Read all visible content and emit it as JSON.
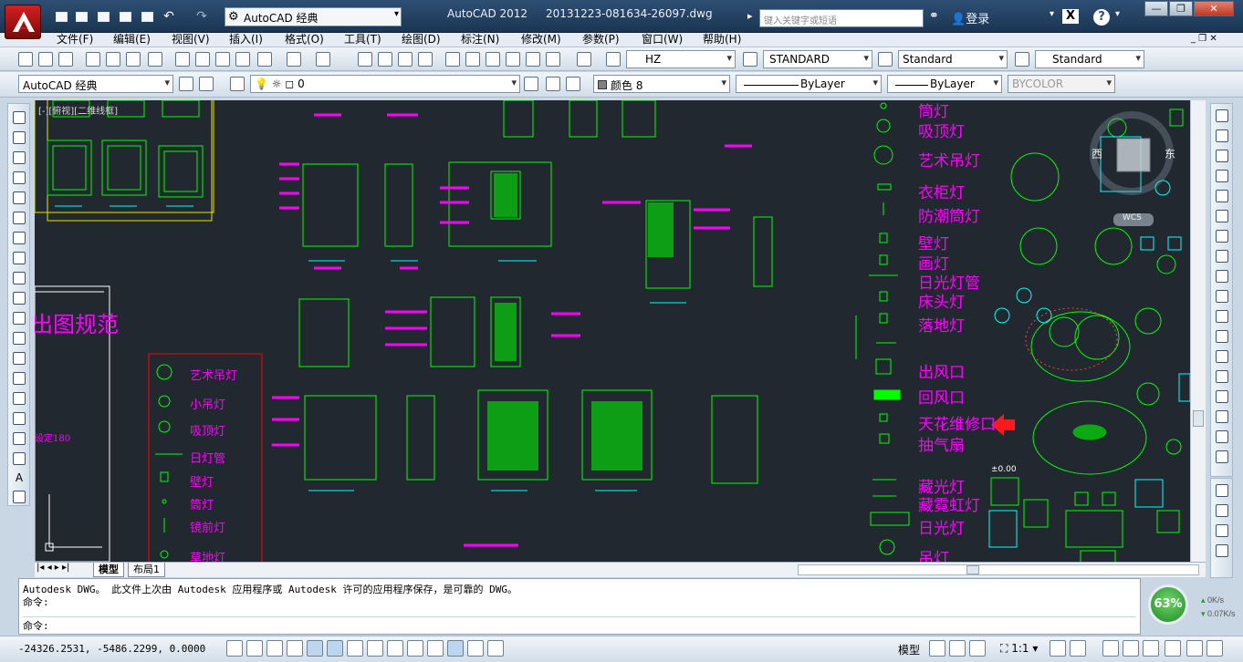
{
  "titlebar": {
    "workspace": "AutoCAD 经典",
    "app_title": "AutoCAD 2012",
    "file_title": "20131223-081634-26097.dwg",
    "search_placeholder": "键入关键字或短语",
    "login": "登录"
  },
  "menu": [
    "文件(F)",
    "编辑(E)",
    "视图(V)",
    "插入(I)",
    "格式(O)",
    "工具(T)",
    "绘图(D)",
    "标注(N)",
    "修改(M)",
    "参数(P)",
    "窗口(W)",
    "帮助(H)"
  ],
  "toolbar": {
    "text_style": "HZ",
    "dim_style": "STANDARD",
    "table_style": "Standard",
    "mleader_style": "Standard",
    "workspace2": "AutoCAD 经典",
    "layer": "0",
    "color": "颜色 8",
    "linetype": "ByLayer",
    "lineweight": "ByLayer",
    "plotstyle": "BYCOLOR"
  },
  "viewcube": {
    "west": "西",
    "east": "东",
    "wcs": "WCS"
  },
  "drawing": {
    "viewport_label": "[-][俯视][二维线框]",
    "big_title": "出图规范",
    "left_legend": [
      "艺术吊灯",
      "小吊灯",
      "吸顶灯",
      "日灯管",
      "壁灯",
      "筒灯",
      "镜前灯",
      "草地灯"
    ],
    "left_small": "设定180",
    "right_legend": [
      "筒灯",
      "吸顶灯",
      "艺术吊灯",
      "衣柜灯",
      "防潮筒灯",
      "壁灯",
      "画灯",
      "日光灯管",
      "床头灯",
      "落地灯",
      "出风口",
      "回风口",
      "天花维修口",
      "抽气扇",
      "藏光灯",
      "藏霓虹灯",
      "日光灯",
      "吊灯"
    ],
    "elev_label": "±0.00"
  },
  "tabs": {
    "model": "模型",
    "layout1": "布局1"
  },
  "command": {
    "line1": "Autodesk DWG。  此文件上次由 Autodesk 应用程序或 Autodesk 许可的应用程序保存，是可靠的 DWG。",
    "line2": "命令:",
    "prompt": "命令:"
  },
  "status": {
    "coords": "-24326.2531, -5486.2299, 0.0000",
    "model": "模型",
    "scale": "1:1"
  },
  "net": {
    "percent": "63%",
    "up": "0K/s",
    "down": "0.07K/s"
  },
  "colors": {
    "canvas": "#212830",
    "magenta": "#ff00ff",
    "green": "#00ff00",
    "cyan": "#00ffff"
  }
}
